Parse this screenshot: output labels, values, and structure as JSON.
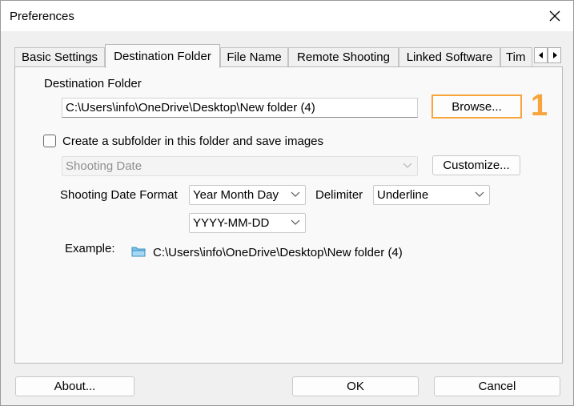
{
  "window": {
    "title": "Preferences"
  },
  "tabs": [
    {
      "label": "Basic Settings"
    },
    {
      "label": "Destination Folder"
    },
    {
      "label": "File Name"
    },
    {
      "label": "Remote Shooting"
    },
    {
      "label": "Linked Software"
    },
    {
      "label": "Tim"
    }
  ],
  "destination": {
    "section_label": "Destination Folder",
    "path_value": "C:\\Users\\info\\OneDrive\\Desktop\\New folder (4)",
    "browse_label": "Browse...",
    "annotation": "1"
  },
  "subfolder": {
    "checkbox_label": "Create a subfolder in this folder and save images",
    "checked": false,
    "mode_value": "Shooting Date",
    "customize_label": "Customize...",
    "date_format_label": "Shooting Date Format",
    "date_format_value": "Year Month Day",
    "delimiter_label": "Delimiter",
    "delimiter_value": "Underline",
    "pattern_value": "YYYY-MM-DD"
  },
  "example": {
    "label": "Example:",
    "path": "C:\\Users\\info\\OneDrive\\Desktop\\New folder (4)"
  },
  "footer": {
    "about_label": "About...",
    "ok_label": "OK",
    "cancel_label": "Cancel"
  },
  "colors": {
    "highlight": "#f7a43c",
    "folder": "#7cc1e8"
  }
}
